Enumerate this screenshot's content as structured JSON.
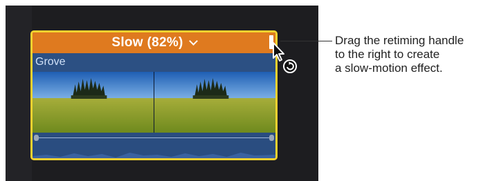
{
  "clip": {
    "retime_label": "Slow (82%)",
    "name": "Grove"
  },
  "callout": {
    "text": "Drag the retiming handle\nto the right to create\na slow-motion effect."
  },
  "icons": {
    "dropdown": "chevron-down-icon",
    "pointer": "arrow-pointer-icon",
    "retime_cursor": "retime-cursor-icon"
  },
  "colors": {
    "retime_bar": "#df7a1f",
    "selection_border": "#f6d22f",
    "clip_body": "#2c5083",
    "timeline_bg": "#1d1d20"
  }
}
